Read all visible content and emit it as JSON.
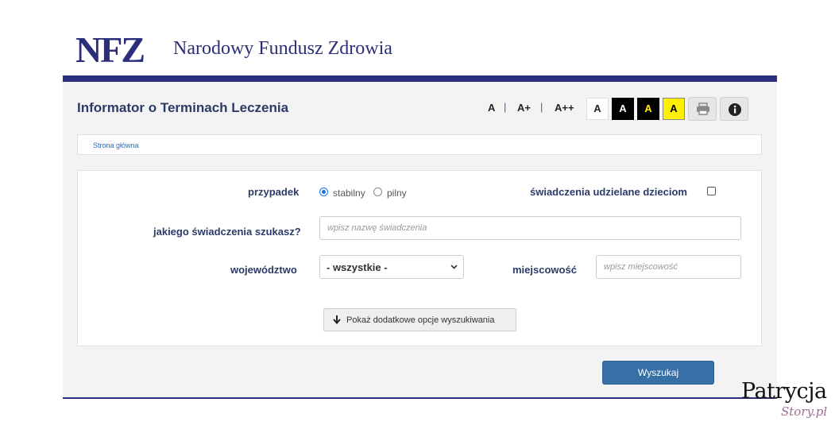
{
  "header": {
    "logo_text": "NFZ",
    "org_name": "Narodowy Fundusz Zdrowia",
    "brand_color": "#2b2e7a"
  },
  "app": {
    "title": "Informator o Terminach Leczenia",
    "font_sizes": [
      "A",
      "A+",
      "A++"
    ],
    "separator": "|",
    "contrast_options": [
      "A",
      "A",
      "A",
      "A"
    ],
    "print_icon": "print-icon",
    "info_icon": "info-icon"
  },
  "breadcrumb": {
    "home": "Strona główna"
  },
  "form": {
    "case_label": "przypadek",
    "case_options": [
      {
        "label": "stabilny",
        "selected": true
      },
      {
        "label": "pilny",
        "selected": false
      }
    ],
    "children_label": "świadczenia udzielane dzieciom",
    "children_checked": false,
    "service_label": "jakiego świadczenia szukasz?",
    "service_placeholder": "wpisz nazwę świadczenia",
    "service_value": "",
    "voivodeship_label": "województwo",
    "voivodeship_value": "- wszystkie -",
    "city_label": "miejscowość",
    "city_placeholder": "wpisz miejscowość",
    "city_value": "",
    "more_options_label": "Pokaż dodatkowe opcje wyszukiwania",
    "search_label": "Wyszukaj",
    "accent_color": "#3770a6"
  },
  "watermark": {
    "line1": "Patrycja",
    "line2": "Story.pl"
  }
}
